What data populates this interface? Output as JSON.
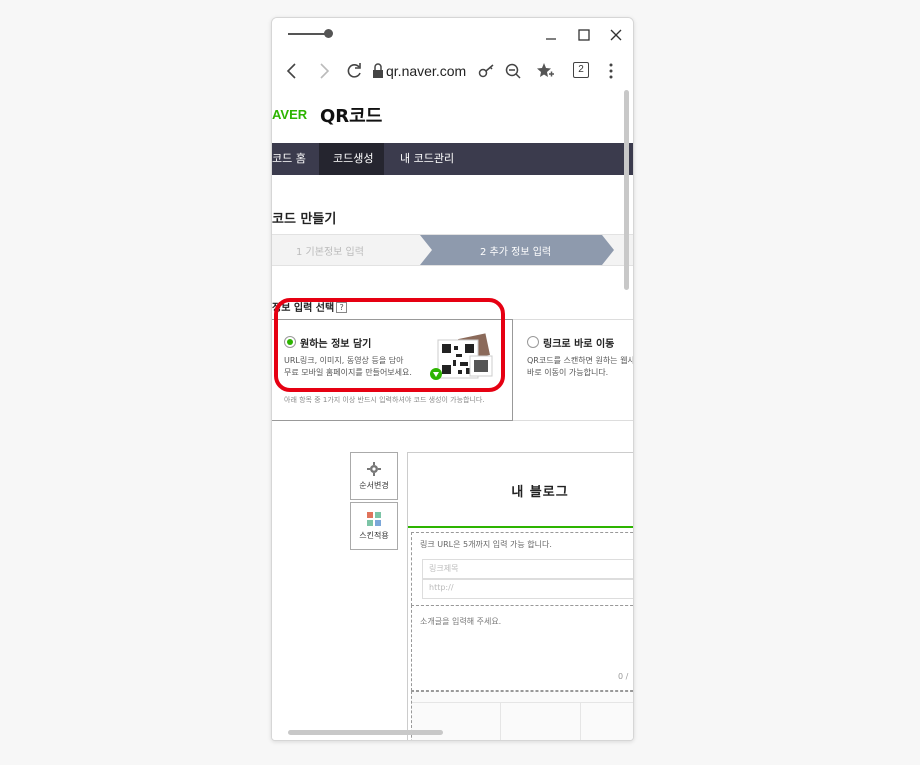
{
  "browser": {
    "url": "qr.naver.com",
    "tab_count": "2",
    "icons": {
      "back": "back-arrow-icon",
      "forward": "forward-arrow-icon",
      "reload": "reload-icon",
      "lock": "lock-icon",
      "key": "key-icon",
      "zoom_out": "zoom-out-icon",
      "bookmark": "star-add-icon",
      "menu": "kebab-menu-icon"
    }
  },
  "header": {
    "logo": "AVER",
    "service_title": "QR코드"
  },
  "gnb": {
    "items": [
      {
        "label": "코드 홈"
      },
      {
        "label": "코드생성"
      },
      {
        "label": "내 코드관리"
      }
    ]
  },
  "main": {
    "page_title": "코드 만들기",
    "steps": [
      {
        "label": "1 기본정보 입력"
      },
      {
        "label": "2 추가 정보 입력"
      }
    ],
    "section_label": "정보 입력 선택",
    "help_glyph": "?",
    "options": [
      {
        "title": "원하는 정보 담기",
        "desc1": "URL링크, 이미지, 동영상 등을 담아",
        "desc2": "무료 모바일 홈페이지를 만들어보세요.",
        "note": "아래 항목 중 1가지 이상 반드시 입력하셔야 코드 생성이 가능합니다.",
        "selected": true
      },
      {
        "title": "링크로 바로 이동",
        "desc1": "QR코드를 스캔하면 원하는 웹사",
        "desc2": "바로 이동이 가능합니다.",
        "selected": false
      }
    ]
  },
  "editor": {
    "order_button": "순서변경",
    "skin_button": "스킨적용",
    "blog_title": "내 블로그",
    "link_hint": "링크 URL은 5개까지 입력 가능 합니다.",
    "link_name_placeholder": "링크제목",
    "link_url_placeholder": "http://",
    "intro_placeholder": "소개글을 입력해 주세요.",
    "char_count": "0 /"
  },
  "colors": {
    "naver_green": "#2db400",
    "gnb_bg": "#3b3b4d",
    "highlight_red": "#e60012"
  }
}
